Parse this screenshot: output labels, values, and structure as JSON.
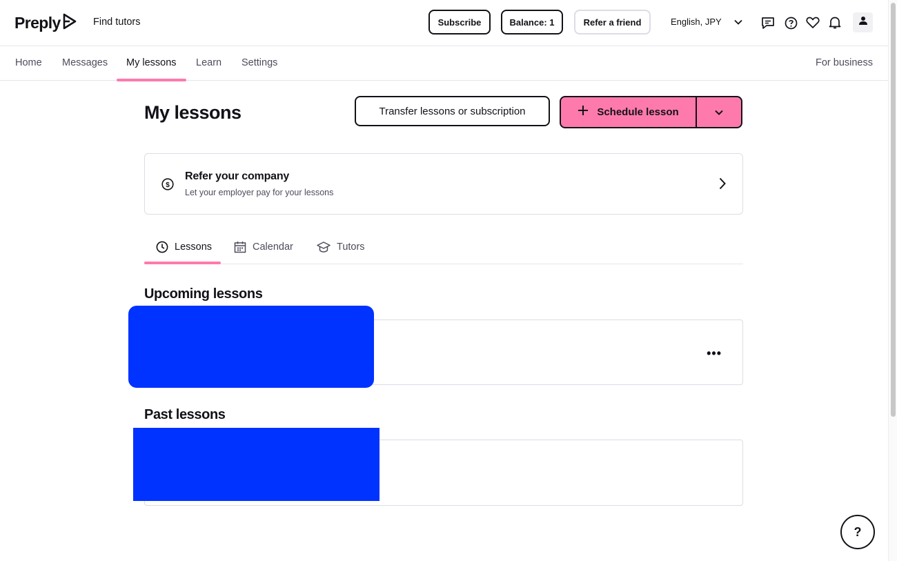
{
  "header": {
    "logo_text": "Preply",
    "find_tutors": "Find tutors",
    "subscribe_label": "Subscribe",
    "balance_label": "Balance: 1",
    "refer_label": "Refer a friend",
    "language_currency": "English, JPY"
  },
  "nav": {
    "items": [
      {
        "label": "Home"
      },
      {
        "label": "Messages"
      },
      {
        "label": "My lessons"
      },
      {
        "label": "Learn"
      },
      {
        "label": "Settings"
      }
    ],
    "active": "My lessons",
    "for_business": "For business"
  },
  "main": {
    "title": "My lessons",
    "transfer_label": "Transfer lessons or subscription",
    "schedule_label": "Schedule lesson",
    "refer_card": {
      "title": "Refer your company",
      "subtitle": "Let your employer pay for your lessons"
    },
    "tabs": [
      {
        "label": "Lessons"
      },
      {
        "label": "Calendar"
      },
      {
        "label": "Tutors"
      }
    ],
    "active_tab": "Lessons",
    "upcoming_title": "Upcoming lessons",
    "past_title": "Past lessons",
    "more_label": "•••"
  },
  "help_label": "?",
  "colors": {
    "accent_pink": "#ff7aac",
    "redaction_blue": "#0033ff",
    "text_dark": "#121117",
    "border_light": "#dcdce5"
  },
  "icons": {
    "messages": "chat-bubble-icon",
    "help": "question-circle-icon",
    "saved": "heart-icon",
    "notifications": "bell-icon",
    "profile": "user-icon"
  }
}
